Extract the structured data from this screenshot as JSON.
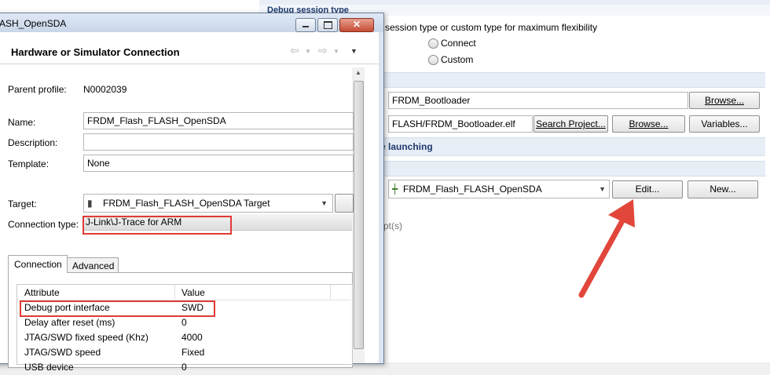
{
  "background_window": {
    "tabs_text": "Debug session type",
    "description": "session type or custom type for maximum flexibility",
    "radio_connect": "Connect",
    "radio_custom": "Custom",
    "project_name": "FRDM_Bootloader",
    "browse_label_1": "Browse...",
    "elf_path": "FLASH/FRDM_Bootloader.elf",
    "search_project_label": "Search Project...",
    "browse_label_2": "Browse...",
    "variables_label": "Variables...",
    "section_launching": "e launching",
    "connection_select": "FRDM_Flash_FLASH_OpenSDA",
    "edit_label": "Edit...",
    "new_label": "New...",
    "partial_text": "pt(s)"
  },
  "dialog": {
    "title": "ASH_OpenSDA",
    "header": "Hardware or Simulator Connection",
    "parent_profile_label": "Parent profile:",
    "parent_profile_value": "N0002039",
    "name_label": "Name:",
    "name_value": "FRDM_Flash_FLASH_OpenSDA",
    "description_label": "Description:",
    "description_value": "",
    "template_label": "Template:",
    "template_value": "None",
    "target_label": "Target:",
    "target_value": "FRDM_Flash_FLASH_OpenSDA Target",
    "connection_type_label": "Connection type:",
    "connection_type_value": "J-Link\\J-Trace for ARM",
    "tabs": [
      "Connection",
      "Advanced"
    ],
    "table": {
      "headers": [
        "Attribute",
        "Value"
      ],
      "rows": [
        [
          "Debug port interface",
          "SWD"
        ],
        [
          "Delay after reset (ms)",
          "0"
        ],
        [
          "JTAG/SWD fixed speed (Khz)",
          "4000"
        ],
        [
          "JTAG/SWD speed",
          "Fixed"
        ],
        [
          "USB device",
          "0"
        ]
      ]
    }
  },
  "colors": {
    "highlight": "#e03a35",
    "arrow": "#e2463b"
  }
}
